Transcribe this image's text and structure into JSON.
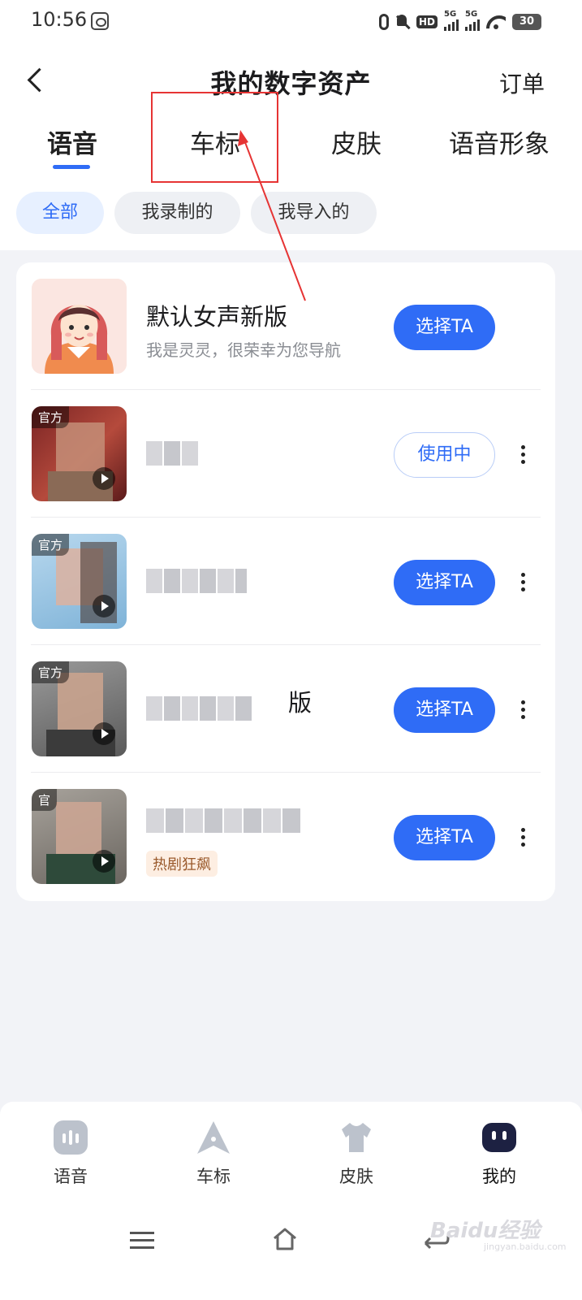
{
  "status_bar": {
    "time": "10:56",
    "hd": "HD",
    "sig1": "5G",
    "sig2": "5G",
    "battery": "30"
  },
  "header": {
    "title": "我的数字资产",
    "orders": "订单"
  },
  "tabs": [
    {
      "label": "语音"
    },
    {
      "label": "车标"
    },
    {
      "label": "皮肤"
    },
    {
      "label": "语音形象"
    }
  ],
  "filters": [
    {
      "label": "全部"
    },
    {
      "label": "我录制的"
    },
    {
      "label": "我导入的"
    }
  ],
  "voices": [
    {
      "title": "默认女声新版",
      "subtitle": "我是灵灵，很荣幸为您导航",
      "button": "选择TA"
    },
    {
      "badge": "官方",
      "button": "使用中"
    },
    {
      "badge": "官方",
      "button": "选择TA"
    },
    {
      "badge": "官方",
      "title_suffix": "版",
      "button": "选择TA"
    },
    {
      "badge": "官",
      "tag": "热剧狂飙",
      "button": "选择TA"
    }
  ],
  "bottom_nav": [
    {
      "label": "语音",
      "icon": "voice-icon"
    },
    {
      "label": "车标",
      "icon": "car-logo-icon"
    },
    {
      "label": "皮肤",
      "icon": "skin-icon"
    },
    {
      "label": "我的",
      "icon": "mine-icon"
    }
  ],
  "watermark": {
    "text": "Baidu经验",
    "sub": "jingyan.baidu.com"
  },
  "colors": {
    "accent": "#2f6cf6",
    "annotation": "#e63434",
    "background": "#f2f3f7"
  }
}
